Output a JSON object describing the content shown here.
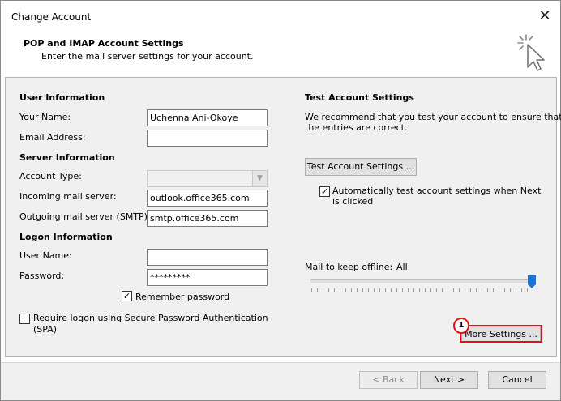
{
  "window": {
    "title": "Change Account",
    "close_glyph": "✕",
    "header_title": "POP and IMAP Account Settings",
    "header_subtitle": "Enter the mail server settings for your account."
  },
  "user_info": {
    "heading": "User Information",
    "name_label": "Your Name:",
    "name_value": "Uchenna Ani-Okoye",
    "email_label": "Email Address:",
    "email_value": ""
  },
  "server_info": {
    "heading": "Server Information",
    "account_type_label": "Account Type:",
    "account_type_value": "",
    "incoming_label": "Incoming mail server:",
    "incoming_value": "outlook.office365.com",
    "outgoing_label": "Outgoing mail server (SMTP):",
    "outgoing_value": "smtp.office365.com"
  },
  "logon_info": {
    "heading": "Logon Information",
    "username_label": "User Name:",
    "username_value": "",
    "password_label": "Password:",
    "password_value": "*********",
    "remember_label": "Remember password",
    "remember_checked": true,
    "spa_label_line1": "Require logon using Secure Password Authentication",
    "spa_label_line2": "(SPA)",
    "spa_checked": false
  },
  "test_settings": {
    "heading": "Test Account Settings",
    "desc_line1": "We recommend that you test your account to ensure that",
    "desc_line2": "the entries are correct.",
    "button_label": "Test Account Settings ...",
    "auto_test_line1": "Automatically test account settings when Next",
    "auto_test_line2": "is clicked",
    "auto_test_checked": true
  },
  "offline": {
    "label": "Mail to keep offline:",
    "value": "All",
    "slider_fraction": 1.0
  },
  "more_settings": {
    "button_label": "More Settings ...",
    "annotation_number": "1",
    "annotation_color": "#e0111c"
  },
  "footer": {
    "back_label": "< Back",
    "next_label": "Next >",
    "cancel_label": "Cancel"
  },
  "icons": {
    "check_glyph": "✓",
    "dropdown_glyph": "▼"
  },
  "colors": {
    "pane_bg": "#f0f0f0",
    "slider_thumb": "#1e74d6"
  }
}
